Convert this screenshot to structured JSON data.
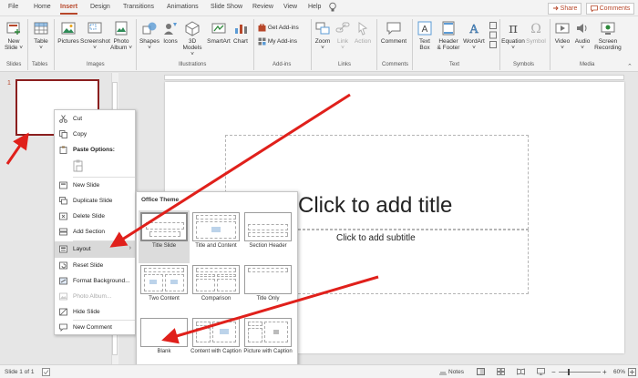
{
  "menu_tabs": [
    "File",
    "Home",
    "Insert",
    "Design",
    "Transitions",
    "Animations",
    "Slide Show",
    "Review",
    "View",
    "Help"
  ],
  "tell_me_icon": "lightbulb-icon",
  "share_label": "Share",
  "comments_label": "Comments",
  "ribbon": {
    "new_slide": [
      "New",
      "Slide ˅"
    ],
    "table": [
      "Table",
      "˅"
    ],
    "pictures": "Pictures",
    "screenshot": [
      "Screenshot",
      "˅"
    ],
    "photo_album": [
      "Photo",
      "Album ˅"
    ],
    "shapes": [
      "Shapes",
      "˅"
    ],
    "icons": "Icons",
    "models_3d": [
      "3D",
      "Models ˅"
    ],
    "smartart": "SmartArt",
    "chart": "Chart",
    "get_addins": "Get Add-ins",
    "my_addins": "My Add-ins",
    "zoom": [
      "Zoom",
      "˅"
    ],
    "link": [
      "Link",
      "˅"
    ],
    "action": "Action",
    "comment": "Comment",
    "text_box": [
      "Text",
      "Box"
    ],
    "header_footer": [
      "Header",
      "& Footer"
    ],
    "wordart": [
      "WordArt",
      "˅"
    ],
    "equation": [
      "Equation",
      "˅"
    ],
    "symbol": "Symbol",
    "video": [
      "Video",
      "˅"
    ],
    "audio": [
      "Audio",
      "˅"
    ],
    "screen_recording": [
      "Screen",
      "Recording"
    ],
    "groups": [
      "Slides",
      "Tables",
      "Images",
      "Illustrations",
      "Add-ins",
      "Links",
      "Comments",
      "Text",
      "Symbols",
      "Media"
    ]
  },
  "slide_number": "1",
  "slide": {
    "title_placeholder": "Click to add title",
    "subtitle_placeholder": "Click to add subtitle"
  },
  "context_menu": {
    "cut": "Cut",
    "copy": "Copy",
    "paste_options": "Paste Options:",
    "new_slide": "New Slide",
    "duplicate_slide": "Duplicate Slide",
    "delete_slide": "Delete Slide",
    "add_section": "Add Section",
    "layout": "Layout",
    "reset_slide": "Reset Slide",
    "format_background": "Format Background...",
    "photo_album": "Photo Album...",
    "hide_slide": "Hide Slide",
    "new_comment": "New Comment"
  },
  "layout_gallery": {
    "header": "Office Theme",
    "layouts": [
      "Title Slide",
      "Title and Content",
      "Section Header",
      "Two Content",
      "Comparison",
      "Title Only",
      "Blank",
      "Content with Caption",
      "Picture with Caption"
    ],
    "selected": "Title Slide"
  },
  "status_bar": {
    "slide_info": "Slide 1 of 1",
    "notes": "Notes",
    "zoom": "60%"
  },
  "colors": {
    "accent": "#b7472a",
    "annotation_arrow": "#e0201b",
    "selected_thumb_border": "#8b1f1f"
  }
}
